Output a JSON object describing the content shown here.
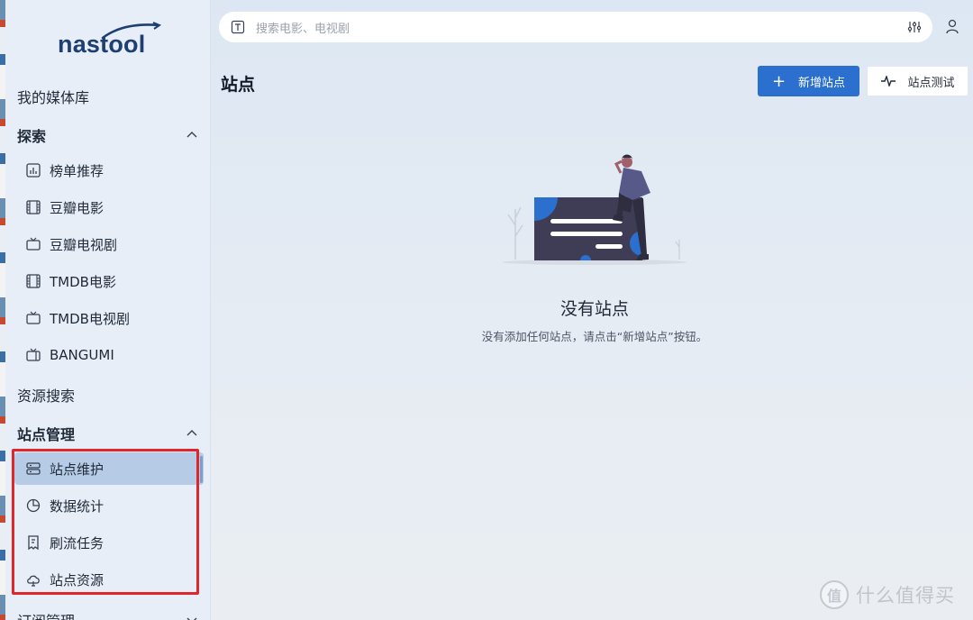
{
  "app": {
    "logo_text": "nastool"
  },
  "sidebar": {
    "media_library": "我的媒体库",
    "explore": {
      "label": "探索",
      "items": [
        {
          "label": "榜单推荐",
          "icon": "chart-bar-icon"
        },
        {
          "label": "豆瓣电影",
          "icon": "film-icon"
        },
        {
          "label": "豆瓣电视剧",
          "icon": "tv-icon"
        },
        {
          "label": "TMDB电影",
          "icon": "film-icon"
        },
        {
          "label": "TMDB电视剧",
          "icon": "tv-icon"
        },
        {
          "label": "BANGUMI",
          "icon": "tv-retro-icon"
        }
      ]
    },
    "resource_search": "资源搜索",
    "site_management": {
      "label": "站点管理",
      "items": [
        {
          "label": "站点维护",
          "icon": "server-icon",
          "active": true
        },
        {
          "label": "数据统计",
          "icon": "pie-chart-icon"
        },
        {
          "label": "刷流任务",
          "icon": "task-icon"
        },
        {
          "label": "站点资源",
          "icon": "cloud-icon"
        }
      ]
    },
    "subscription": {
      "label": "订阅管理"
    }
  },
  "search": {
    "placeholder": "搜索电影、电视剧"
  },
  "page": {
    "title": "站点",
    "add_site_label": "新增站点",
    "test_site_label": "站点测试"
  },
  "empty_state": {
    "title": "没有站点",
    "description": "没有添加任何站点，请点击“新增站点”按钮。"
  },
  "watermark": {
    "glyph": "值",
    "text": "什么值得买"
  },
  "colors": {
    "primary": "#2b6fcf",
    "active_item": "#b6cbe6",
    "highlight_box": "#e0262b",
    "logo": "#1e3f72"
  }
}
